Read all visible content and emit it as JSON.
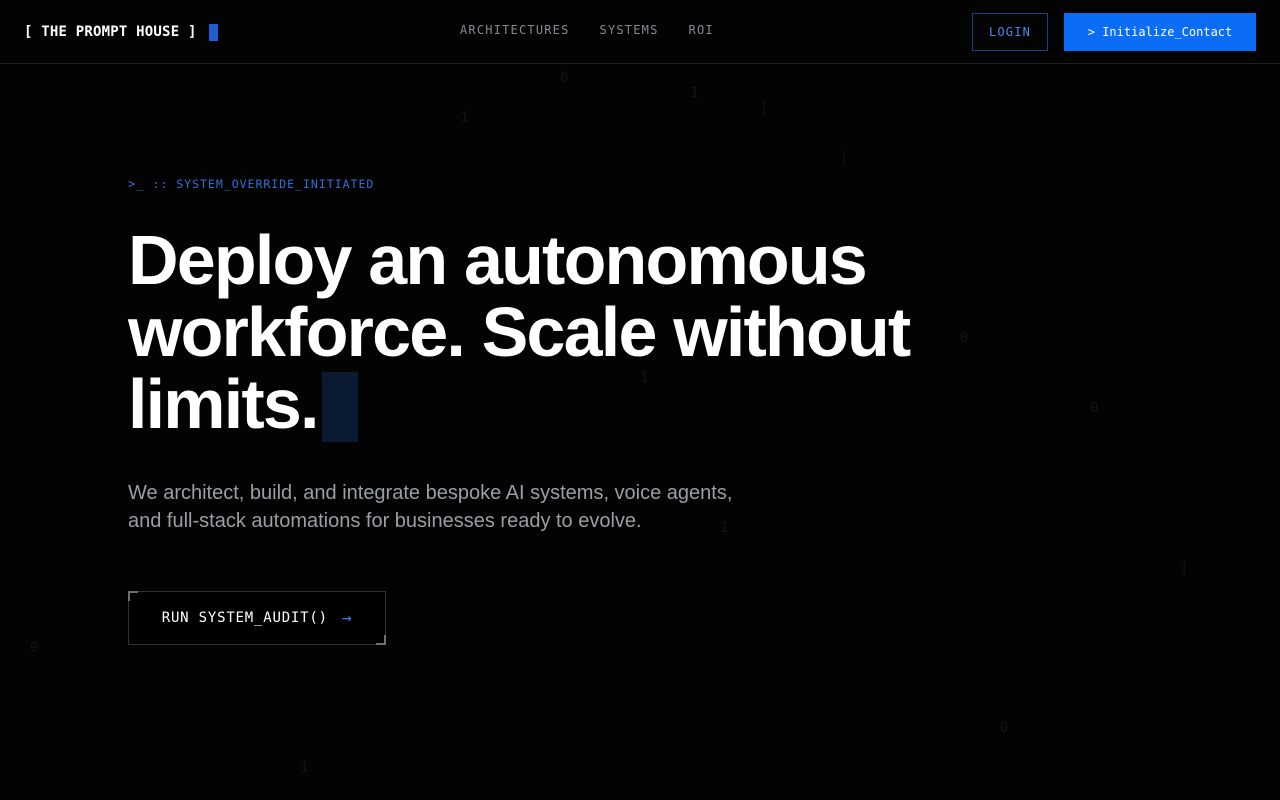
{
  "header": {
    "brand": "[ THE PROMPT HOUSE ]",
    "nav": [
      {
        "label": "ARCHITECTURES"
      },
      {
        "label": "SYSTEMS"
      },
      {
        "label": "ROI"
      }
    ],
    "login_label": "LOGIN",
    "contact_label": "> Initialize_Contact"
  },
  "hero": {
    "prompt_symbol": ">_",
    "prompt_text": ":: SYSTEM_OVERRIDE_INITIATED",
    "headline": "Deploy an autonomous workforce. Scale without limits.",
    "subtext_line1": "We architect, build, and integrate bespoke AI systems, voice agents,",
    "subtext_line2": "and full-stack automations for businesses ready to evolve.",
    "cta_label": "RUN SYSTEM_AUDIT()",
    "cta_icon": "arrow-right-icon"
  },
  "colors": {
    "background": "#030303",
    "accent": "#0b6df5",
    "accent_text": "#2f6fdc",
    "muted_text": "#9a9ea5"
  }
}
